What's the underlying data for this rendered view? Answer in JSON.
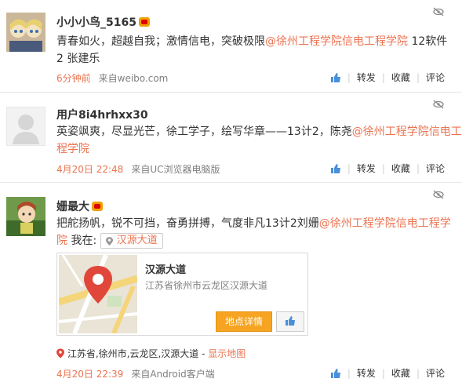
{
  "posts": [
    {
      "username": "小小小鸟_5165",
      "text_main": "青春如火，超越自我；激情信电，突破极限",
      "mention": "@徐州工程学院信电工程学院",
      "text_tail": " 12软件2 张建乐",
      "time": "6分钟前",
      "source": "来自weibo.com",
      "actions": {
        "repost": "转发",
        "favorite": "收藏",
        "comment": "评论"
      }
    },
    {
      "username": "用户8i4hrhxx30",
      "text_main": "英姿飒爽，尽显光芒，徐工学子，绘写华章——13计2，陈尧",
      "mention": "@徐州工程学院信电工程学院",
      "time": "4月20日 22:48",
      "source": "来自UC浏览器电脑版",
      "actions": {
        "repost": "转发",
        "favorite": "收藏",
        "comment": "评论"
      }
    },
    {
      "username": "姗最大",
      "text_main": "把舵扬帆，锐不可挡，奋勇拼搏，气度非凡13计2刘姗",
      "mention": "@徐州工程学院信电工程学院",
      "checkin_label": "我在:",
      "checkin_place": "汉源大道",
      "card": {
        "title": "汉源大道",
        "address": "江苏省徐州市云龙区汉源大道",
        "detail_button": "地点详情"
      },
      "location_text": "江苏省,徐州市,云龙区,汉源大道",
      "location_sep": " - ",
      "location_link": "显示地图",
      "time": "4月20日 22:39",
      "source": "来自Android客户端",
      "actions": {
        "repost": "转发",
        "favorite": "收藏",
        "comment": "评论"
      }
    }
  ]
}
